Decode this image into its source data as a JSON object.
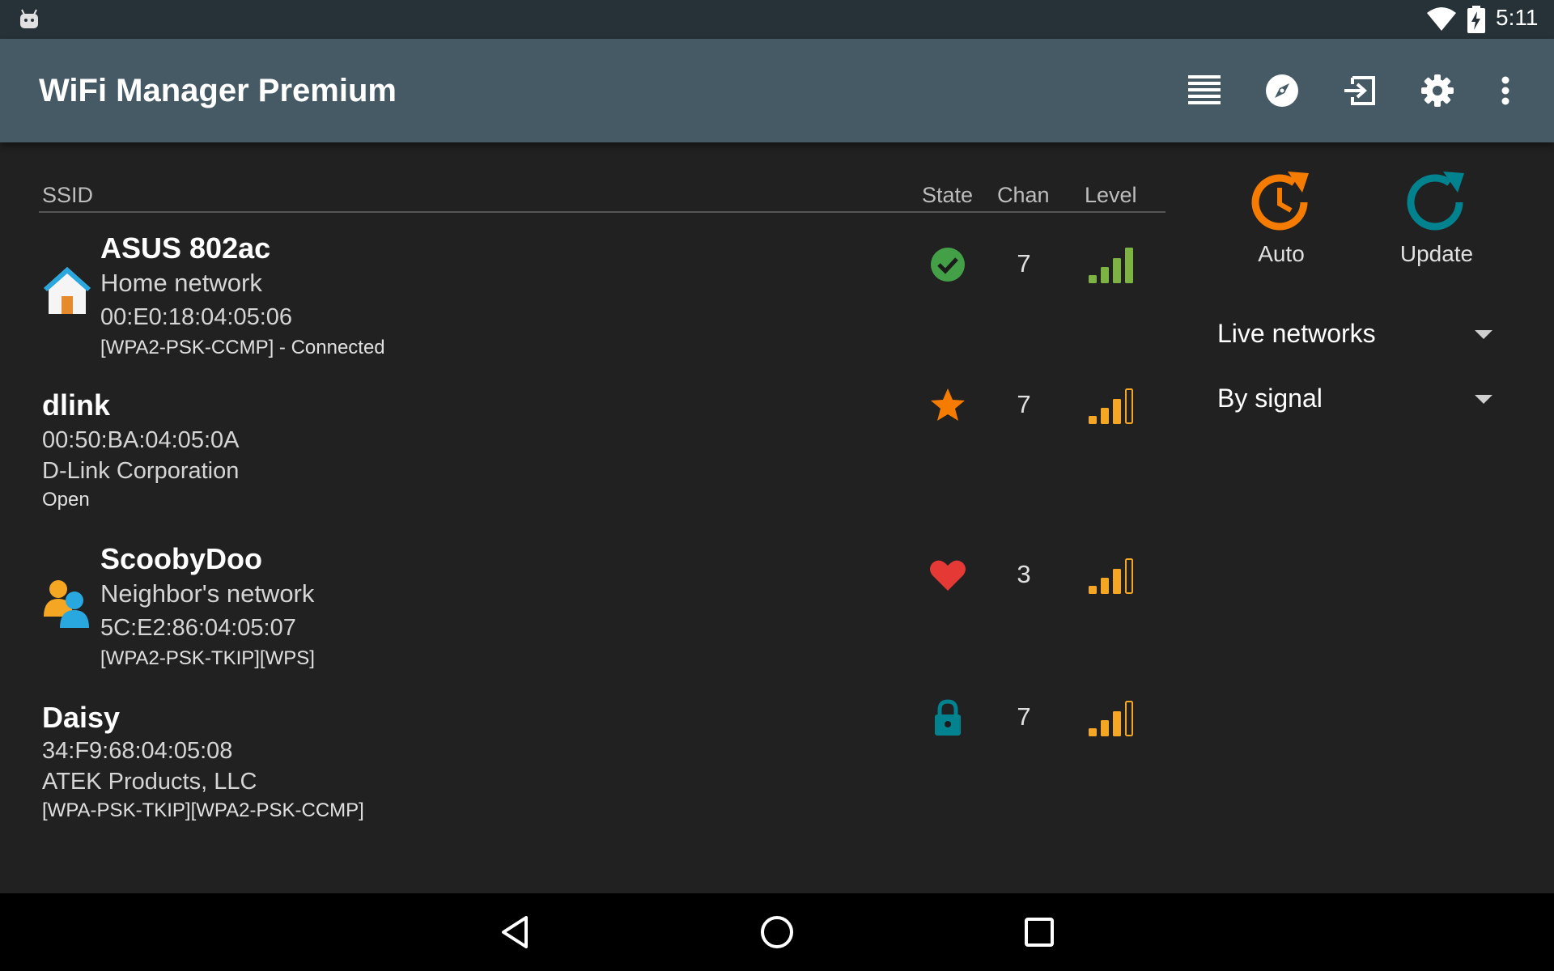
{
  "status_bar": {
    "time": "5:11",
    "icons": [
      "android-icon",
      "wifi-signal-icon",
      "battery-charging-icon"
    ]
  },
  "app_bar": {
    "title": "WiFi Manager Premium",
    "actions": [
      "list-view-icon",
      "compass-icon",
      "connect-icon",
      "gear-icon",
      "overflow-menu-icon"
    ]
  },
  "table": {
    "headers": {
      "ssid": "SSID",
      "state": "State",
      "chan": "Chan",
      "level": "Level"
    }
  },
  "networks": [
    {
      "ssid": "ASUS 802ac",
      "label": "Home network",
      "mac": "00:E0:18:04:05:06",
      "security": "[WPA2-PSK-CCMP] - Connected",
      "icon": "home-icon",
      "state_icon": "check-circle-icon",
      "channel": "7",
      "signal_bars": 4,
      "signal_color": "#7cb342"
    },
    {
      "ssid": "dlink",
      "mac": "00:50:BA:04:05:0A",
      "vendor": "D-Link Corporation",
      "security": "Open",
      "state_icon": "star-icon",
      "channel": "7",
      "signal_bars": 3,
      "signal_color": "#f5a623"
    },
    {
      "ssid": "ScoobyDoo",
      "label": "Neighbor's network",
      "mac": "5C:E2:86:04:05:07",
      "security": "[WPA2-PSK-TKIP][WPS]",
      "icon": "neighbor-icon",
      "state_icon": "heart-icon",
      "channel": "3",
      "signal_bars": 3,
      "signal_color": "#f5a623"
    },
    {
      "ssid": "Daisy",
      "mac": "34:F9:68:04:05:08",
      "vendor": "ATEK Products, LLC",
      "security": "[WPA-PSK-TKIP][WPA2-PSK-CCMP]",
      "state_icon": "lock-icon",
      "channel": "7",
      "signal_bars": 3,
      "signal_color": "#f5a623"
    }
  ],
  "right_panel": {
    "auto_label": "Auto",
    "update_label": "Update",
    "filter_value": "Live networks",
    "sort_value": "By signal"
  },
  "colors": {
    "app_bar": "#455a64",
    "status_bar": "#263238",
    "background": "#212121",
    "accent_orange": "#f57c00",
    "accent_teal": "#00838f",
    "signal_green": "#7cb342",
    "signal_yellow": "#f5a623"
  },
  "nav_bar": {
    "buttons": [
      "back-icon",
      "home-nav-icon",
      "recents-icon"
    ]
  }
}
